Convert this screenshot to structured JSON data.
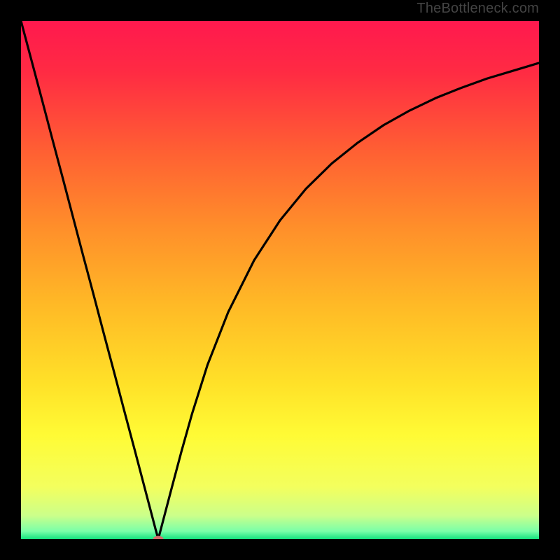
{
  "watermark": "TheBottleneck.com",
  "chart_data": {
    "type": "line",
    "title": "",
    "xlabel": "",
    "ylabel": "",
    "xlim": [
      0,
      1
    ],
    "ylim": [
      0,
      1
    ],
    "gradient_stops": [
      {
        "offset": 0.0,
        "color": "#ff194e"
      },
      {
        "offset": 0.1,
        "color": "#ff2b43"
      },
      {
        "offset": 0.25,
        "color": "#ff5f33"
      },
      {
        "offset": 0.4,
        "color": "#ff8f2a"
      },
      {
        "offset": 0.55,
        "color": "#ffba26"
      },
      {
        "offset": 0.7,
        "color": "#ffe128"
      },
      {
        "offset": 0.8,
        "color": "#fffb35"
      },
      {
        "offset": 0.9,
        "color": "#f3ff5e"
      },
      {
        "offset": 0.955,
        "color": "#cbff8a"
      },
      {
        "offset": 0.985,
        "color": "#7affa9"
      },
      {
        "offset": 1.0,
        "color": "#16e27f"
      }
    ],
    "series": [
      {
        "name": "bottleneck-curve",
        "x": [
          0.0,
          0.02,
          0.04,
          0.06,
          0.08,
          0.1,
          0.12,
          0.14,
          0.16,
          0.18,
          0.2,
          0.22,
          0.24,
          0.26,
          0.265,
          0.275,
          0.29,
          0.31,
          0.33,
          0.36,
          0.4,
          0.45,
          0.5,
          0.55,
          0.6,
          0.65,
          0.7,
          0.75,
          0.8,
          0.85,
          0.9,
          0.95,
          1.0
        ],
        "y": [
          1.0,
          0.925,
          0.85,
          0.774,
          0.699,
          0.623,
          0.547,
          0.472,
          0.396,
          0.321,
          0.245,
          0.17,
          0.094,
          0.018,
          0.0,
          0.038,
          0.095,
          0.17,
          0.241,
          0.336,
          0.438,
          0.538,
          0.615,
          0.676,
          0.725,
          0.765,
          0.799,
          0.827,
          0.851,
          0.871,
          0.889,
          0.904,
          0.919
        ]
      }
    ],
    "marker": {
      "x": 0.265,
      "y": 0.0,
      "rx": 0.01,
      "ry": 0.006,
      "color": "#d46a6a"
    }
  }
}
